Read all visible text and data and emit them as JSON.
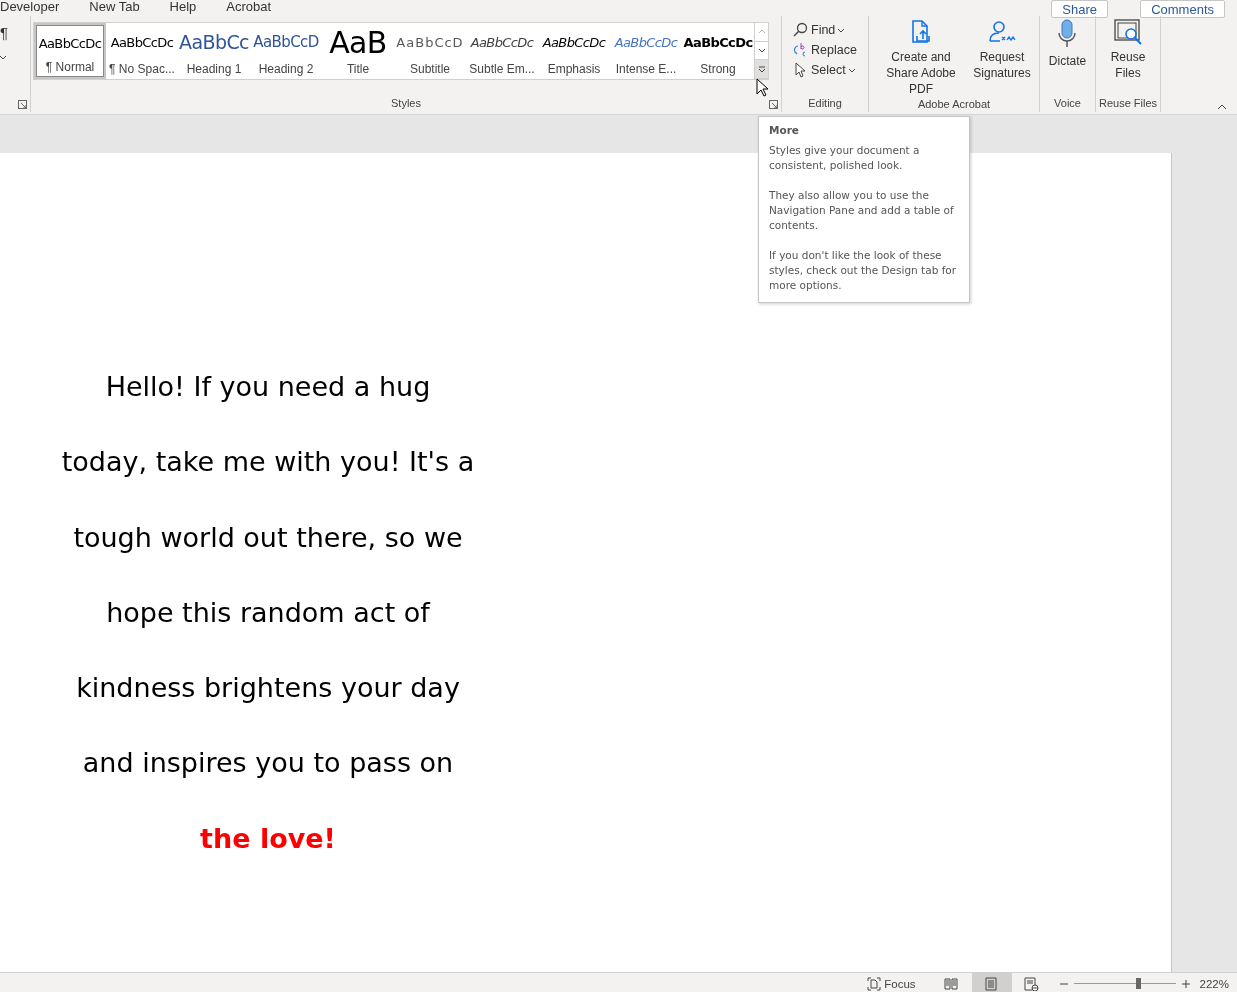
{
  "tabs": [
    {
      "label": "Developer"
    },
    {
      "label": "New Tab"
    },
    {
      "label": "Help"
    },
    {
      "label": "Acrobat"
    }
  ],
  "formatting_mark": "¶",
  "share_button": "Share",
  "comments_button": "Comments",
  "styles_gallery": {
    "items": [
      {
        "preview": "AaBbCcDc",
        "label": "¶ Normal",
        "kind": "normal",
        "selected": true
      },
      {
        "preview": "AaBbCcDc",
        "label": "¶ No Spac...",
        "kind": "normal",
        "selected": false
      },
      {
        "preview": "AaBbCc",
        "label": "Heading 1",
        "kind": "heading1",
        "selected": false
      },
      {
        "preview": "AaBbCcD",
        "label": "Heading 2",
        "kind": "heading2",
        "selected": false
      },
      {
        "preview": "AaB",
        "label": "Title",
        "kind": "title",
        "selected": false
      },
      {
        "preview": "AaBbCcD",
        "label": "Subtitle",
        "kind": "subtitle",
        "selected": false
      },
      {
        "preview": "AaBbCcDc",
        "label": "Subtle Em...",
        "kind": "subtle",
        "selected": false
      },
      {
        "preview": "AaBbCcDc",
        "label": "Emphasis",
        "kind": "emphasis",
        "selected": false
      },
      {
        "preview": "AaBbCcDc",
        "label": "Intense E...",
        "kind": "intense",
        "selected": false
      },
      {
        "preview": "AaBbCcDc",
        "label": "Strong",
        "kind": "strong",
        "selected": false
      }
    ],
    "group_label": "Styles"
  },
  "editing": {
    "items": [
      {
        "label": "Find",
        "kind": "find"
      },
      {
        "label": "Replace",
        "kind": "replace"
      },
      {
        "label": "Select",
        "kind": "select"
      }
    ],
    "group_label": "Editing"
  },
  "groups": [
    {
      "group_label": "Adobe Acrobat",
      "buttons": [
        {
          "label": "Create and Share Adobe PDF",
          "kind": "pdf"
        },
        {
          "label": "Request Signatures",
          "kind": "sign"
        }
      ]
    },
    {
      "group_label": "Voice",
      "buttons": [
        {
          "label": "Dictate",
          "kind": "mic"
        }
      ]
    },
    {
      "group_label": "Reuse Files",
      "buttons": [
        {
          "label": "Reuse Files",
          "kind": "reuse"
        }
      ]
    }
  ],
  "tooltip": {
    "title": "More",
    "paragraphs": [
      "Styles give your document a consistent, polished look.",
      "They also allow you to use the Navigation Pane and add a table of contents.",
      "If you don't like the look of these styles, check out the Design tab for more options."
    ]
  },
  "document": {
    "lines": [
      {
        "text": "Hello! If you need a hug",
        "kind": "normal"
      },
      {
        "text": "today, take me with you! It's a",
        "kind": "normal"
      },
      {
        "text": "tough world out there, so we",
        "kind": "normal"
      },
      {
        "text": "hope this random act of",
        "kind": "normal"
      },
      {
        "text": "kindness brightens your day",
        "kind": "normal"
      },
      {
        "text": "and inspires you to pass on",
        "kind": "normal"
      },
      {
        "text": "the love!",
        "kind": "highlight"
      }
    ]
  },
  "status_bar": {
    "focus": "Focus",
    "views": [
      {
        "kind": "read",
        "selected": false
      },
      {
        "kind": "print",
        "selected": true
      },
      {
        "kind": "web",
        "selected": false
      }
    ],
    "zoom": {
      "level": 0.64,
      "reading": "222%"
    }
  }
}
